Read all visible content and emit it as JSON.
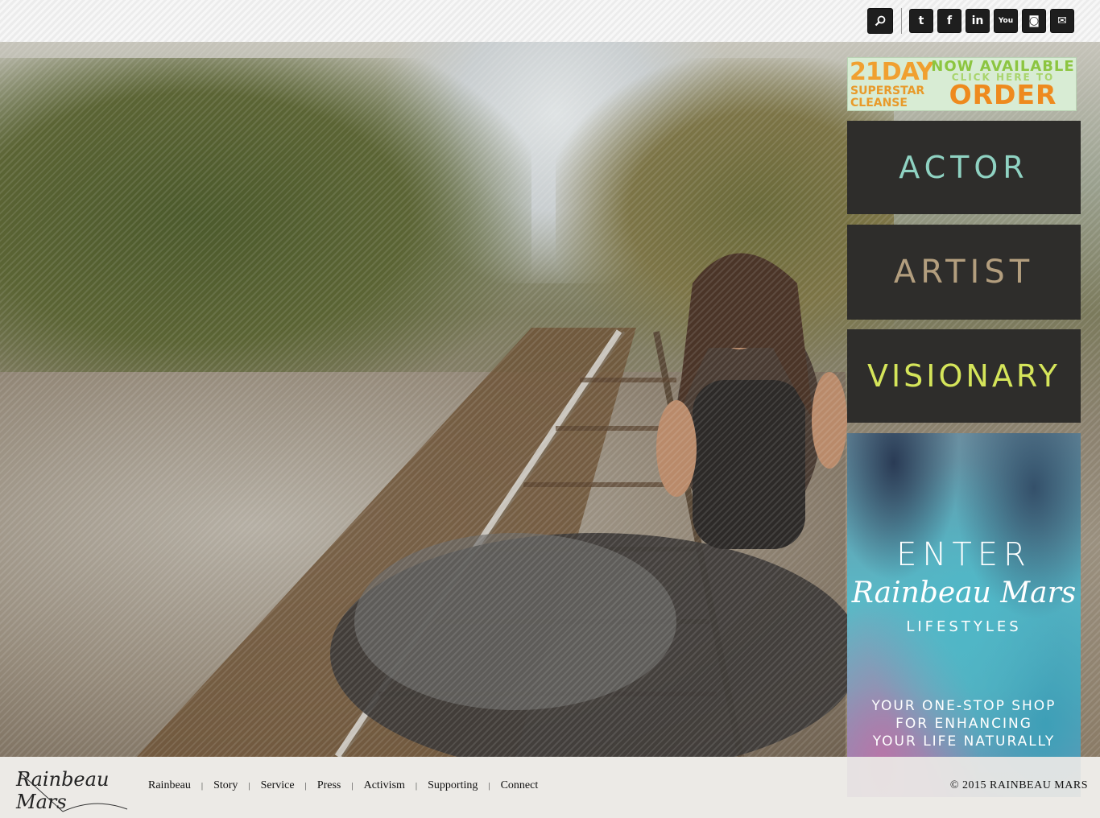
{
  "header": {
    "search_icon": "search-icon",
    "social": [
      {
        "name": "twitter",
        "glyph": "t"
      },
      {
        "name": "facebook",
        "glyph": "f"
      },
      {
        "name": "linkedin",
        "glyph": "in"
      },
      {
        "name": "youtube",
        "glyph": "You"
      },
      {
        "name": "instagram",
        "glyph": "◙"
      },
      {
        "name": "email",
        "glyph": "✉"
      }
    ]
  },
  "banner": {
    "number": "21DAY",
    "line1": "SUPERSTAR",
    "line2": "CLEANSE",
    "available": "NOW AVAILABLE",
    "click": "CLICK HERE TO",
    "order": "ORDER"
  },
  "tiles": {
    "actor": "ACTOR",
    "artist": "ARTIST",
    "visionary": "VISIONARY"
  },
  "lifestyle": {
    "enter": "ENTER",
    "signature": "Rainbeau Mars",
    "lifestyles": "LIFESTYLES",
    "tagline": [
      "YOUR ONE-STOP SHOP",
      "FOR ENHANCING",
      "YOUR LIFE NATURALLY"
    ]
  },
  "footer": {
    "logo": "Rainbeau Mars",
    "nav": [
      "Rainbeau",
      "Story",
      "Service",
      "Press",
      "Activism",
      "Supporting",
      "Connect"
    ],
    "copyright": "© 2015 RAINBEAU MARS"
  },
  "colors": {
    "tile_bg": "#2e2d2b",
    "actor": "#8fd2c2",
    "artist": "#b39e7e",
    "visionary": "#d5e55a"
  }
}
